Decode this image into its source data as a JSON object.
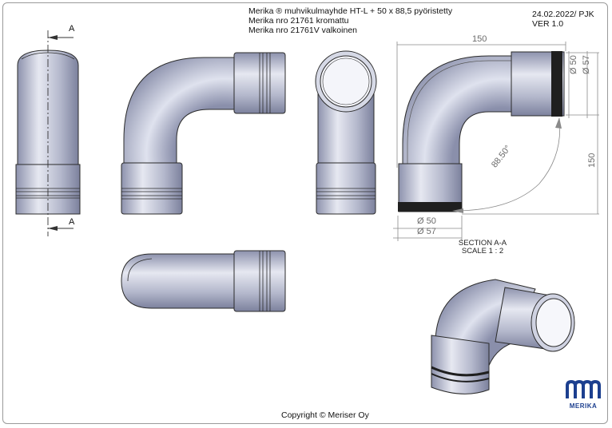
{
  "title": {
    "line1": "Merika ®  muhvikulmayhde HT-L + 50 x 88,5 pyöristetty",
    "line2": "Merika nro  21761  kromattu",
    "line3": "Merika nro  21761V  valkoinen"
  },
  "meta": {
    "date": "24.02.2022/ PJK",
    "version": "VER 1.0"
  },
  "section_marker": "A",
  "dimensions": {
    "width": "150",
    "height": "150",
    "inner_dia_top": "Ø 50",
    "outer_dia_top": "Ø 57",
    "inner_dia_bottom": "Ø 50",
    "outer_dia_bottom": "Ø 57",
    "angle": "88.50°"
  },
  "section": {
    "label": "SECTION A-A",
    "scale": "SCALE 1 : 2"
  },
  "logo": {
    "text": "MERIKA"
  },
  "copyright": "Copyright © Meriser Oy",
  "colors": {
    "pipe": "#b9bdd2",
    "pipe_dark": "#7f849f",
    "pipe_light": "#e9ebf4",
    "line": "#2b2b2b",
    "dim": "#8a8a8a",
    "logo": "#1c3f8f"
  }
}
